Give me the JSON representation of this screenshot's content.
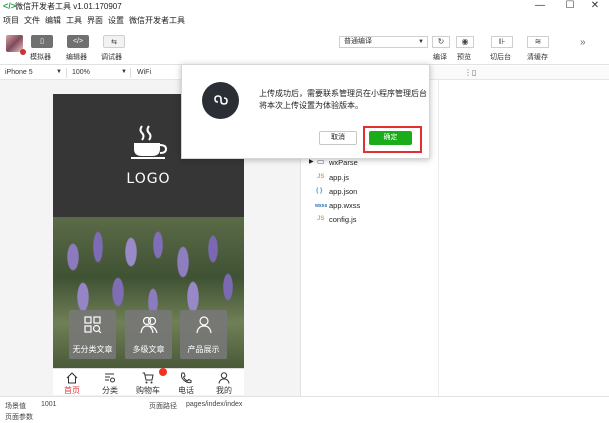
{
  "titlebar": {
    "app_title": "微信开发者工具 v1.01.170907",
    "minimize": "—",
    "maximize": "☐",
    "close": "✕"
  },
  "menu": [
    "项目",
    "文件",
    "编辑",
    "工具",
    "界面",
    "设置",
    "微信开发者工具"
  ],
  "toolbar": {
    "simulator_label": "模拟器",
    "editor_label": "编辑器",
    "debugger_label": "调试器",
    "compile_mode": "普通编译",
    "compile_label": "编译",
    "preview_label": "预览",
    "background_label": "切后台",
    "clear_cache_label": "清缓存"
  },
  "devicebar": {
    "device": "iPhone 5",
    "zoom": "100%",
    "network": "WiFi"
  },
  "phone": {
    "logo_text": "LOGO",
    "categories": [
      "无分类文章",
      "多级文章",
      "产品展示"
    ],
    "tabs": [
      "首页",
      "分类",
      "购物车",
      "电话",
      "我的"
    ],
    "active_tab": "首页"
  },
  "files": [
    "wxParse",
    "app.js",
    "app.json",
    "app.wxss",
    "config.js"
  ],
  "file_types": [
    "JS",
    "{ }",
    "wxss",
    "JS"
  ],
  "dialog": {
    "message": "上传成功后，需要联系管理员在小程序管理后台将本次上传设置为体验版本。",
    "cancel": "取消",
    "confirm": "确定"
  },
  "statusbar": {
    "scene_label": "场景值",
    "scene_value": "1001",
    "path_label": "页面路径",
    "path_value": "pages/index/index",
    "params_label": "页面参数"
  },
  "colors": {
    "confirm_green": "#1aad19",
    "highlight_red": "#e03030",
    "active_tab_red": "#e0393e"
  }
}
